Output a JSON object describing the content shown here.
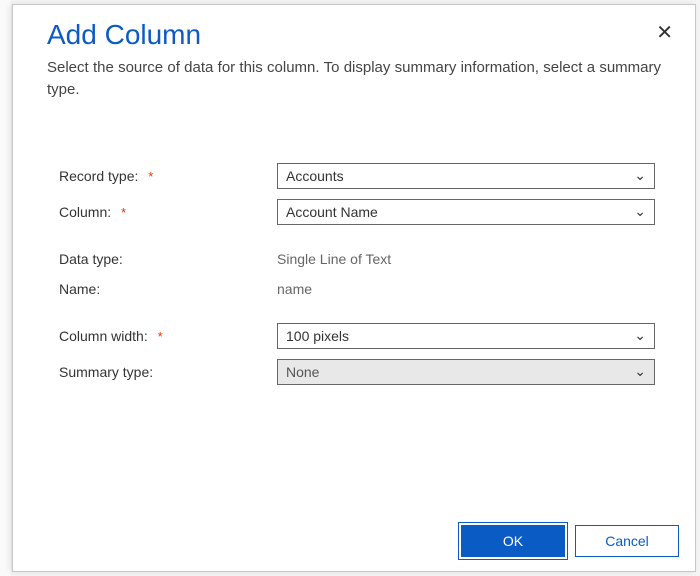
{
  "dialog": {
    "title": "Add Column",
    "description": "Select the source of data for this column. To display summary information, select a summary type."
  },
  "fields": {
    "recordType": {
      "label": "Record type:",
      "value": "Accounts",
      "required": true
    },
    "column": {
      "label": "Column:",
      "value": "Account Name",
      "required": true
    },
    "dataType": {
      "label": "Data type:",
      "value": "Single Line of Text"
    },
    "name": {
      "label": "Name:",
      "value": "name"
    },
    "columnWidth": {
      "label": "Column width:",
      "value": "100 pixels",
      "required": true
    },
    "summaryType": {
      "label": "Summary type:",
      "value": "None"
    }
  },
  "buttons": {
    "ok": "OK",
    "cancel": "Cancel"
  },
  "requiredMark": "*"
}
